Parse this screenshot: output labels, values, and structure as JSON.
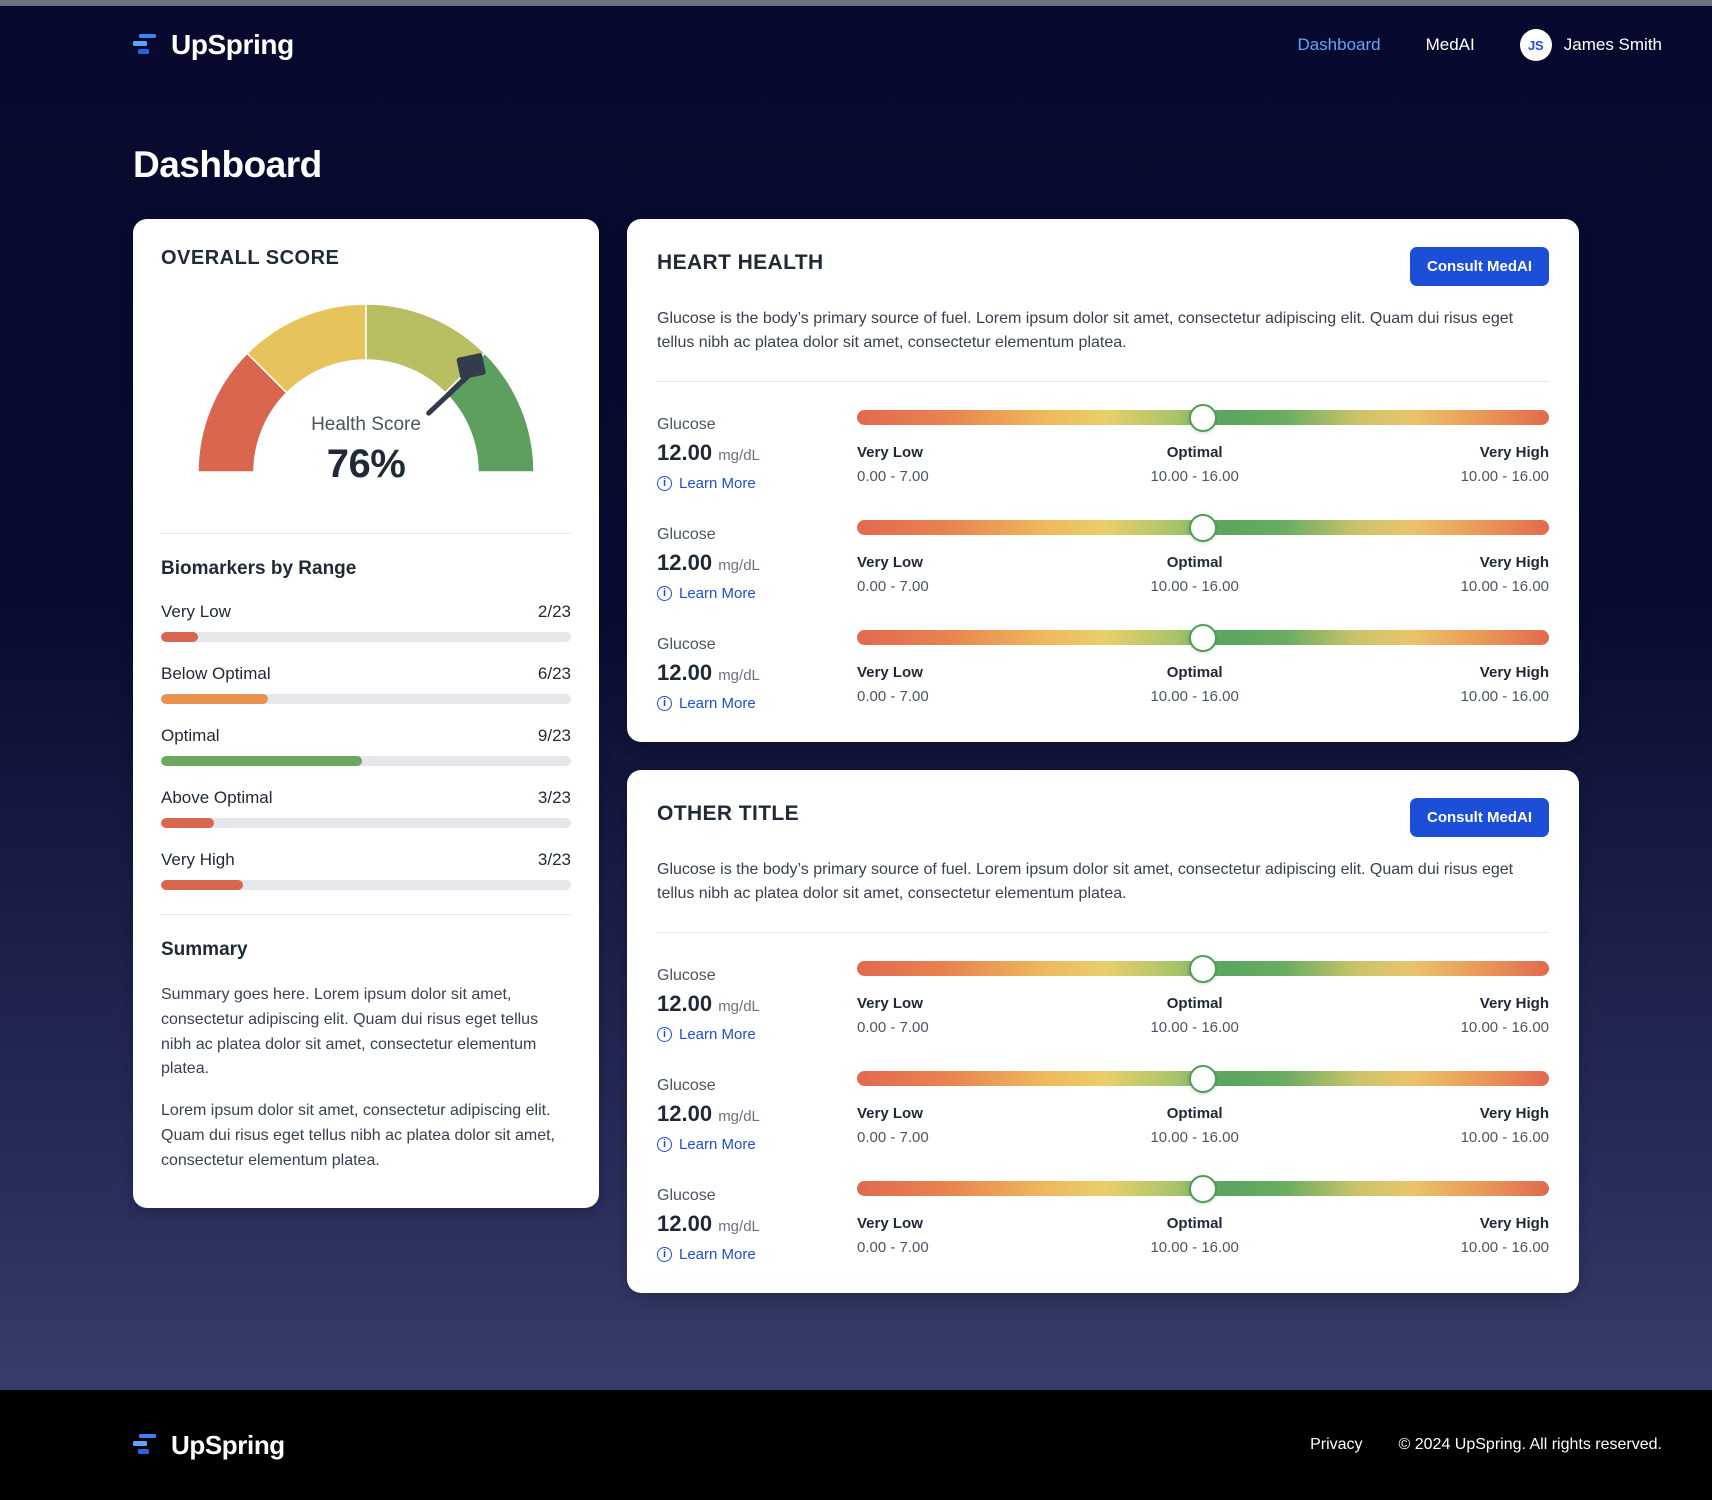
{
  "brand": {
    "name": "UpSpring"
  },
  "nav": {
    "links": [
      {
        "label": "Dashboard",
        "active": true
      },
      {
        "label": "MedAI",
        "active": false
      }
    ],
    "user": {
      "initials": "JS",
      "name": "James Smith"
    }
  },
  "page": {
    "title": "Dashboard"
  },
  "score_card": {
    "kicker": "OVERALL SCORE",
    "gauge": {
      "label": "Health Score",
      "value": "76%",
      "percent": 76,
      "segments": [
        {
          "name": "low",
          "color": "#d9664f",
          "from": 0,
          "to": 25
        },
        {
          "name": "below",
          "color": "#e7c35c",
          "from": 25,
          "to": 50
        },
        {
          "name": "above",
          "color": "#b8bf63",
          "from": 50,
          "to": 75
        },
        {
          "name": "optimal",
          "color": "#5d9f5f",
          "from": 75,
          "to": 100
        }
      ]
    },
    "ranges_title": "Biomarkers by Range",
    "ranges": [
      {
        "label": "Very Low",
        "count": "2/23",
        "percent": 9,
        "color": "#d9664f"
      },
      {
        "label": "Below Optimal",
        "count": "6/23",
        "percent": 26,
        "color": "#e8924f"
      },
      {
        "label": "Optimal",
        "count": "9/23",
        "percent": 49,
        "color": "#6aa85f"
      },
      {
        "label": "Above Optimal",
        "count": "3/23",
        "percent": 13,
        "color": "#d9664f"
      },
      {
        "label": "Very High",
        "count": "3/23",
        "percent": 20,
        "color": "#d9664f"
      }
    ],
    "summary_title": "Summary",
    "summary_paragraphs": [
      "Summary goes here. Lorem ipsum dolor sit amet, consectetur adipiscing elit. Quam dui risus eget tellus nibh ac platea dolor sit amet, consectetur elementum platea.",
      "Lorem ipsum dolor sit amet, consectetur adipiscing elit. Quam dui risus eget tellus nibh ac platea dolor sit amet, consectetur elementum platea."
    ]
  },
  "panels": [
    {
      "title": "HEART HEALTH",
      "action_label": "Consult MedAI",
      "description": "Glucose is the body’s primary source of fuel. Lorem ipsum dolor sit amet, consectetur adipiscing elit. Quam dui risus eget tellus nibh ac platea dolor sit amet, consectetur elementum platea.",
      "biomarkers": [
        {
          "name": "Glucose",
          "value": "12.00",
          "unit": "mg/dL",
          "learn_more": "Learn More",
          "thumb_percent": 50,
          "legend": [
            {
              "name": "Very Low",
              "range": "0.00 - 7.00"
            },
            {
              "name": "Optimal",
              "range": "10.00 - 16.00"
            },
            {
              "name": "Very High",
              "range": "10.00 - 16.00"
            }
          ]
        },
        {
          "name": "Glucose",
          "value": "12.00",
          "unit": "mg/dL",
          "learn_more": "Learn More",
          "thumb_percent": 50,
          "legend": [
            {
              "name": "Very Low",
              "range": "0.00 - 7.00"
            },
            {
              "name": "Optimal",
              "range": "10.00 - 16.00"
            },
            {
              "name": "Very High",
              "range": "10.00 - 16.00"
            }
          ]
        },
        {
          "name": "Glucose",
          "value": "12.00",
          "unit": "mg/dL",
          "learn_more": "Learn More",
          "thumb_percent": 50,
          "legend": [
            {
              "name": "Very Low",
              "range": "0.00 - 7.00"
            },
            {
              "name": "Optimal",
              "range": "10.00 - 16.00"
            },
            {
              "name": "Very High",
              "range": "10.00 - 16.00"
            }
          ]
        }
      ]
    },
    {
      "title": "OTHER TITLE",
      "action_label": "Consult MedAI",
      "description": "Glucose is the body’s primary source of fuel. Lorem ipsum dolor sit amet, consectetur adipiscing elit. Quam dui risus eget tellus nibh ac platea dolor sit amet, consectetur elementum platea.",
      "biomarkers": [
        {
          "name": "Glucose",
          "value": "12.00",
          "unit": "mg/dL",
          "learn_more": "Learn More",
          "thumb_percent": 50,
          "legend": [
            {
              "name": "Very Low",
              "range": "0.00 - 7.00"
            },
            {
              "name": "Optimal",
              "range": "10.00 - 16.00"
            },
            {
              "name": "Very High",
              "range": "10.00 - 16.00"
            }
          ]
        },
        {
          "name": "Glucose",
          "value": "12.00",
          "unit": "mg/dL",
          "learn_more": "Learn More",
          "thumb_percent": 50,
          "legend": [
            {
              "name": "Very Low",
              "range": "0.00 - 7.00"
            },
            {
              "name": "Optimal",
              "range": "10.00 - 16.00"
            },
            {
              "name": "Very High",
              "range": "10.00 - 16.00"
            }
          ]
        },
        {
          "name": "Glucose",
          "value": "12.00",
          "unit": "mg/dL",
          "learn_more": "Learn More",
          "thumb_percent": 50,
          "legend": [
            {
              "name": "Very Low",
              "range": "0.00 - 7.00"
            },
            {
              "name": "Optimal",
              "range": "10.00 - 16.00"
            },
            {
              "name": "Very High",
              "range": "10.00 - 16.00"
            }
          ]
        }
      ]
    }
  ],
  "footer": {
    "brand": "UpSpring",
    "privacy_label": "Privacy",
    "copyright": "© 2024 UpSpring. All rights reserved."
  },
  "colors": {
    "accent_blue": "#1d4ed8",
    "nav_active": "#60a5fa",
    "bg_navy": "#070a2e"
  }
}
